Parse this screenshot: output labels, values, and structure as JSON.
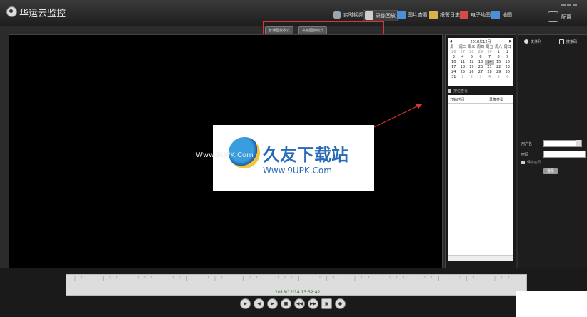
{
  "app": {
    "title": "华运云监控"
  },
  "nav": [
    {
      "label": "实时视频",
      "icon": "camera-icon",
      "color": "#9aa6b2"
    },
    {
      "label": "录像回放",
      "icon": "playback-icon",
      "color": "#cfcfcf"
    },
    {
      "label": "图片查看",
      "icon": "image-icon",
      "color": "#4a8fd8"
    },
    {
      "label": "报警日志",
      "icon": "log-icon",
      "color": "#d8b24a"
    },
    {
      "label": "电子地图",
      "icon": "map-pin-icon",
      "color": "#d84a4a"
    },
    {
      "label": "地图",
      "icon": "map-icon",
      "color": "#4a8fd8"
    }
  ],
  "config": {
    "label": "配置"
  },
  "modes": {
    "normal": "普通回放模式",
    "advanced": "高级回放模式"
  },
  "watermark": {
    "title": "久友下载站",
    "url": "Www.9UPK.Com",
    "side_text": "Www.9UPK.Com"
  },
  "calendar": {
    "month": "2018年12月",
    "weekdays": [
      "周一",
      "周二",
      "周三",
      "周四",
      "周五",
      "周六",
      "周日"
    ],
    "days": [
      [
        "26",
        "27",
        "28",
        "29",
        "30",
        "1",
        "2"
      ],
      [
        "3",
        "4",
        "5",
        "6",
        "7",
        "8",
        "9"
      ],
      [
        "10",
        "11",
        "12",
        "13",
        "14",
        "15",
        "16"
      ],
      [
        "17",
        "18",
        "19",
        "20",
        "21",
        "22",
        "23"
      ],
      [
        "24",
        "25",
        "26",
        "27",
        "28",
        "29",
        "30"
      ],
      [
        "31",
        "1",
        "2",
        "3",
        "4",
        "5",
        "6"
      ]
    ],
    "selected": "14",
    "checkbox_label": "按位查看"
  },
  "list": {
    "col_start": "开始时间",
    "col_type": "录像类型"
  },
  "right_panel": {
    "tab1": "文件列",
    "tab2": "搜索码",
    "user_label": "用户名",
    "password_label": "密码",
    "remember_label": "保存密码",
    "login_label": "登录"
  },
  "timeline": {
    "timestamp": "2018/12/14 13:32:42"
  }
}
